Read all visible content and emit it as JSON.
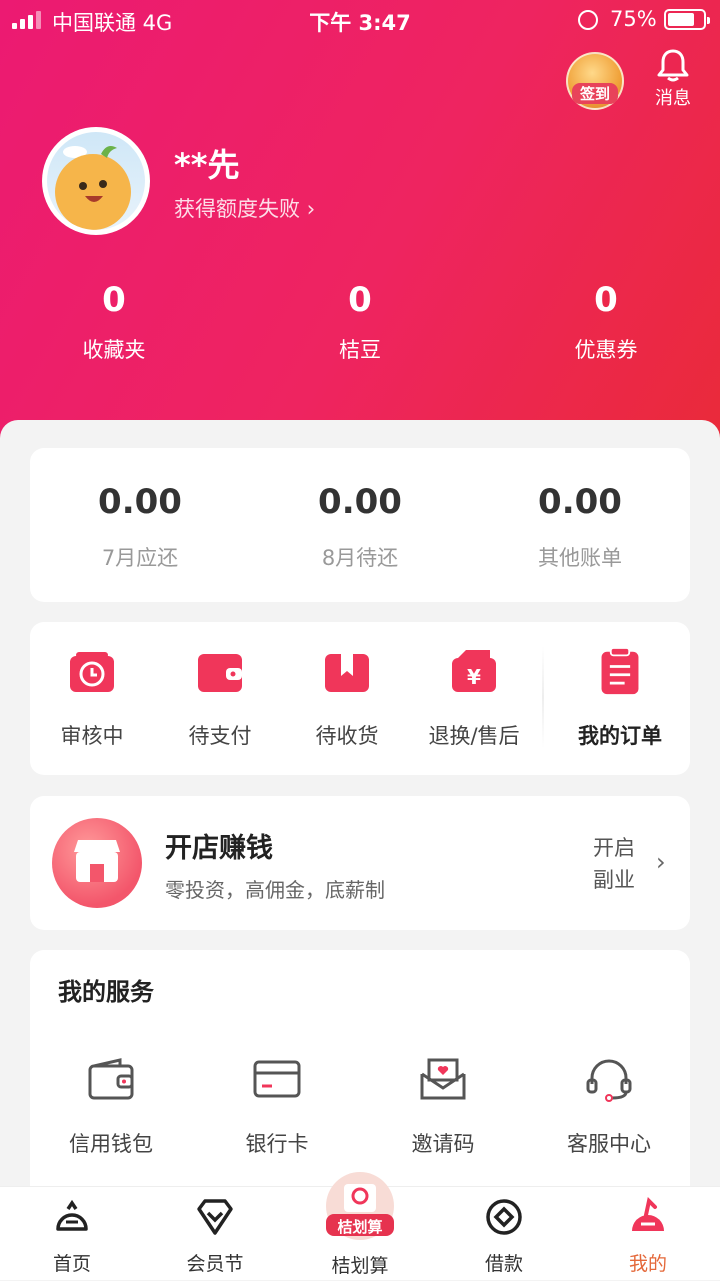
{
  "status_bar": {
    "carrier": "中国联通  4G",
    "time": "下午 3:47",
    "battery": "75%",
    "battery_level": 0.75
  },
  "header": {
    "signin_label": "签到",
    "message_label": "消息",
    "user_name": "**先",
    "user_sub": "获得额度失败",
    "sub_chevron": "›",
    "stats": [
      {
        "value": "0",
        "label": "收藏夹"
      },
      {
        "value": "0",
        "label": "桔豆"
      },
      {
        "value": "0",
        "label": "优惠券"
      }
    ]
  },
  "bills": [
    {
      "value": "0.00",
      "label": "7月应还"
    },
    {
      "value": "0.00",
      "label": "8月待还"
    },
    {
      "value": "0.00",
      "label": "其他账单"
    }
  ],
  "orders": {
    "items": [
      {
        "label": "审核中",
        "icon": "clock-icon"
      },
      {
        "label": "待支付",
        "icon": "wallet-icon"
      },
      {
        "label": "待收货",
        "icon": "package-icon"
      },
      {
        "label": "退换/售后",
        "icon": "yen-refund-icon"
      }
    ],
    "my_orders": "我的订单",
    "accent": "#f0365a"
  },
  "shop": {
    "title": "开店赚钱",
    "subtitle": "零投资，高佣金，底薪制",
    "action_line1": "开启",
    "action_line2": "副业",
    "chevron": "›"
  },
  "services": {
    "title": "我的服务",
    "items": [
      {
        "label": "信用钱包",
        "icon": "wallet-outline-icon"
      },
      {
        "label": "银行卡",
        "icon": "bank-card-icon"
      },
      {
        "label": "邀请码",
        "icon": "invite-envelope-icon"
      },
      {
        "label": "客服中心",
        "icon": "headset-icon"
      }
    ]
  },
  "tabbar": {
    "items": [
      {
        "label": "首页",
        "icon": "home-bell-icon"
      },
      {
        "label": "会员节",
        "icon": "member-heart-icon"
      },
      {
        "label": "桔划算",
        "icon": "promo-badge-icon"
      },
      {
        "label": "借款",
        "icon": "loan-coin-icon"
      },
      {
        "label": "我的",
        "icon": "me-icon",
        "active": true
      }
    ],
    "promo_badge": "桔划算",
    "active_color": "#e4683a"
  }
}
